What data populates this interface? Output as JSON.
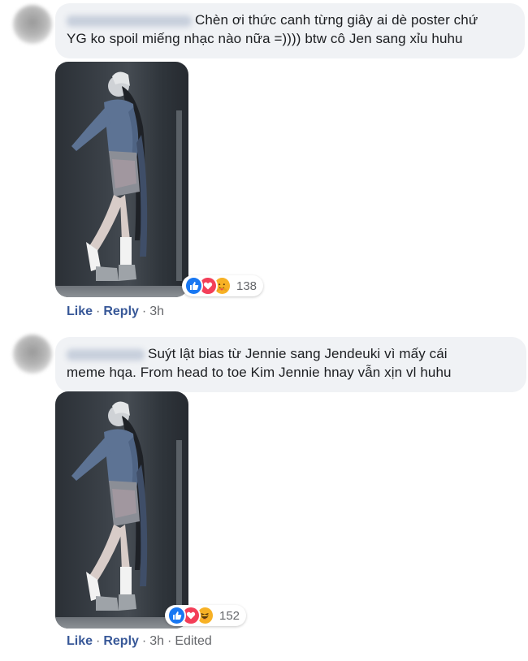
{
  "comments": [
    {
      "text_line1": "Chèn ơi thức canh từng giây ai dè poster chứ",
      "text_line2": "YG ko spoil miếng nhạc nào nữa =)))) btw cô Jen sang xỉu huhu",
      "reaction_count": "138",
      "reaction_icons": [
        "like-icon",
        "love-icon",
        "care-icon"
      ],
      "actions": {
        "like": "Like",
        "reply": "Reply",
        "time": "3h",
        "edited": "",
        "separator": "·"
      }
    },
    {
      "text_line1": "Suýt lật bias từ Jennie sang Jendeuki vì mấy cái",
      "text_line2": "meme hqa. From head to toe Kim Jennie hnay vẫn xịn vl huhu",
      "reaction_count": "152",
      "reaction_icons": [
        "like-icon",
        "love-icon",
        "haha-icon"
      ],
      "actions": {
        "like": "Like",
        "reply": "Reply",
        "time": "3h",
        "edited": "Edited",
        "separator": "·"
      }
    }
  ],
  "colors": {
    "bubble": "#f0f2f5",
    "link": "#385898",
    "meta_text": "#65676b",
    "like_blue": "#1877f2",
    "love_red": "#f33e58",
    "emoji_yellow": "#f7b125"
  }
}
